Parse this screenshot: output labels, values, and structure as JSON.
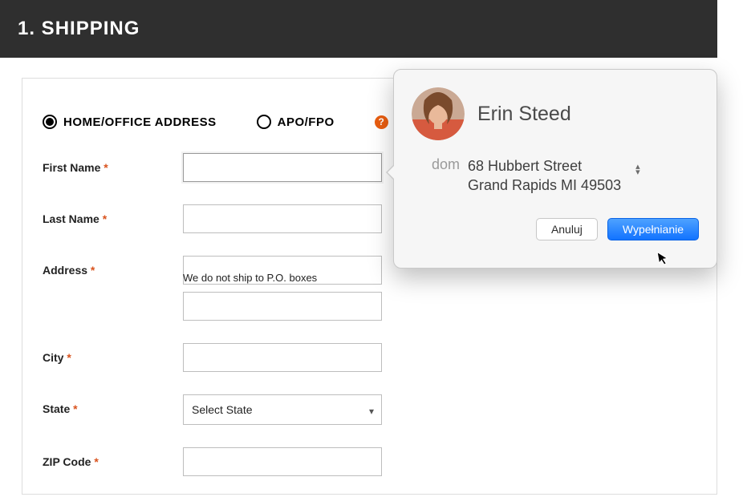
{
  "header": {
    "title": "1. SHIPPING"
  },
  "radios": {
    "home_label": "HOME/OFFICE ADDRESS",
    "apo_label": "APO/FPO"
  },
  "fields": {
    "first_name": {
      "label": "First Name"
    },
    "last_name": {
      "label": "Last Name"
    },
    "address": {
      "label": "Address",
      "helper": "We do not ship to P.O. boxes"
    },
    "city": {
      "label": "City"
    },
    "state": {
      "label": "State",
      "placeholder": "Select State"
    },
    "zip": {
      "label": "ZIP Code"
    }
  },
  "required_marker": "*",
  "help_icon_text": "?",
  "popover": {
    "contact_name": "Erin Steed",
    "address_tag": "dom",
    "address_line1": "68 Hubbert Street",
    "address_line2": "Grand Rapids MI 49503",
    "cancel_label": "Anuluj",
    "fill_label": "Wypełnianie"
  }
}
